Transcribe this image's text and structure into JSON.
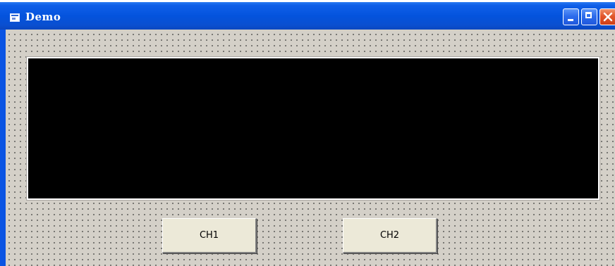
{
  "window": {
    "title": "Demo",
    "icon": "form-icon"
  },
  "title_controls": {
    "minimize": "minimize-icon",
    "maximize": "maximize-icon",
    "close": "close-icon"
  },
  "form": {
    "display_color": "#000000",
    "background_color": "#d4d0c8",
    "buttons": [
      {
        "label": "CH1"
      },
      {
        "label": "CH2"
      }
    ]
  },
  "colors": {
    "titlebar": "#0453dd",
    "close_button": "#e2562c",
    "button_face": "#ece9d8"
  }
}
